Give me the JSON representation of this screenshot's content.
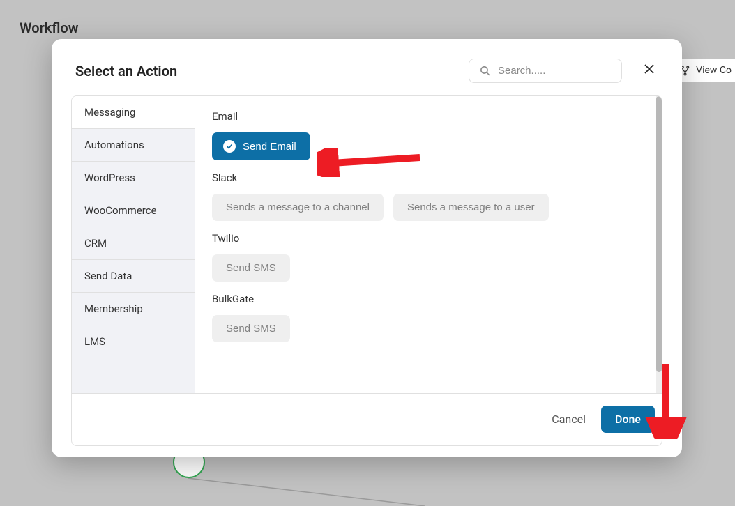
{
  "bg": {
    "title": "Workflow",
    "view_button": "View Co"
  },
  "modal": {
    "title": "Select an Action",
    "search_placeholder": "Search.....",
    "sidebar": [
      {
        "label": "Messaging",
        "active": true
      },
      {
        "label": "Automations"
      },
      {
        "label": "WordPress"
      },
      {
        "label": "WooCommerce"
      },
      {
        "label": "CRM"
      },
      {
        "label": "Send Data"
      },
      {
        "label": "Membership"
      },
      {
        "label": "LMS"
      }
    ],
    "sections": [
      {
        "heading": "Email",
        "actions": [
          {
            "label": "Send Email",
            "selected": true
          }
        ]
      },
      {
        "heading": "Slack",
        "actions": [
          {
            "label": "Sends a message to a channel"
          },
          {
            "label": "Sends a message to a user"
          }
        ]
      },
      {
        "heading": "Twilio",
        "actions": [
          {
            "label": "Send SMS"
          }
        ]
      },
      {
        "heading": "BulkGate",
        "actions": [
          {
            "label": "Send SMS"
          }
        ]
      }
    ],
    "footer": {
      "cancel": "Cancel",
      "done": "Done"
    }
  },
  "colors": {
    "primary": "#0d6fa6",
    "arrow": "#ed1c24"
  }
}
